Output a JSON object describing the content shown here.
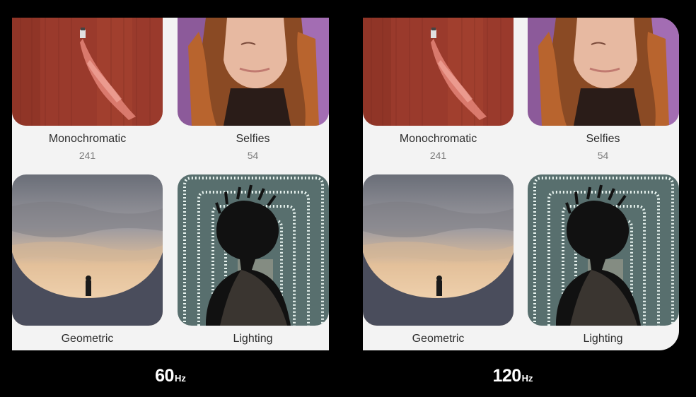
{
  "comparison": {
    "left": {
      "value": "60",
      "unit": "Hz"
    },
    "right": {
      "value": "120",
      "unit": "Hz"
    }
  },
  "albums": [
    {
      "name": "Monochromatic",
      "count": "241"
    },
    {
      "name": "Selfies",
      "count": "54"
    },
    {
      "name": "Geometric"
    },
    {
      "name": "Lighting"
    }
  ],
  "colors": {
    "background": "#000000",
    "panel": "#f3f3f3",
    "text_primary": "#2e2e2e",
    "text_secondary": "#7a7a7a"
  }
}
